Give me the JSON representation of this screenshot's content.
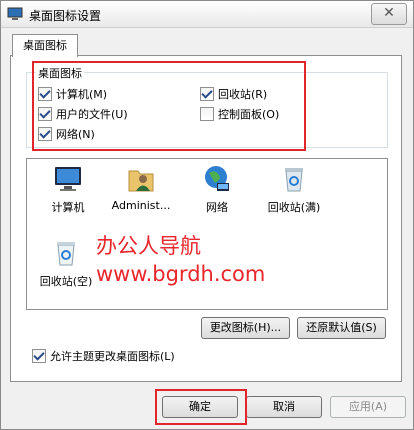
{
  "window": {
    "title": "桌面图标设置",
    "close_label": "✕"
  },
  "tabs": [
    {
      "label": "桌面图标"
    }
  ],
  "desktop_icons_group": {
    "label": "桌面图标",
    "items": [
      {
        "label": "计算机(M)",
        "checked": true
      },
      {
        "label": "回收站(R)",
        "checked": true
      },
      {
        "label": "用户的文件(U)",
        "checked": true
      },
      {
        "label": "控制面板(O)",
        "checked": false
      },
      {
        "label": "网络(N)",
        "checked": true
      }
    ]
  },
  "icon_list": [
    {
      "label": "计算机",
      "icon": "computer-icon"
    },
    {
      "label": "Administ...",
      "icon": "user-folder-icon"
    },
    {
      "label": "网络",
      "icon": "network-icon"
    },
    {
      "label": "回收站(满)",
      "icon": "recycle-bin-full-icon"
    },
    {
      "label": "回收站(空)",
      "icon": "recycle-bin-empty-icon"
    }
  ],
  "buttons": {
    "change_icon": "更改图标(H)...",
    "restore_default": "还原默认值(S)",
    "ok": "确定",
    "cancel": "取消",
    "apply": "应用(A)"
  },
  "allow_themes": {
    "label": "允许主题更改桌面图标(L)",
    "checked": true
  },
  "watermark": {
    "line1": "办公人导航",
    "line2": "www.bgrdh.com"
  },
  "colors": {
    "highlight": "#e0252b",
    "watermark": "#e8262c"
  }
}
